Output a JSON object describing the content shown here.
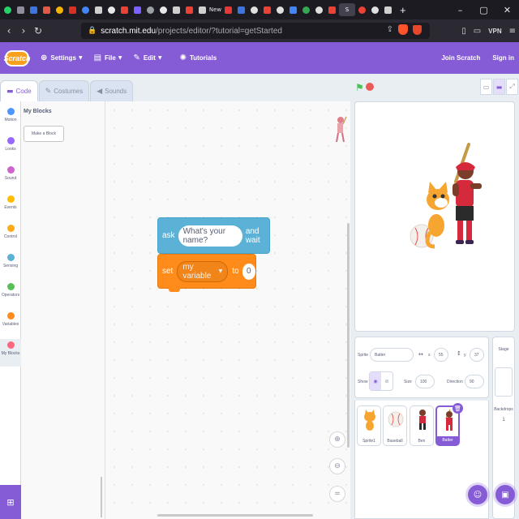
{
  "browser": {
    "tabs": [
      {
        "color": "#25d366",
        "round": true
      },
      {
        "color": "#8e8e9e",
        "round": false
      },
      {
        "color": "#3f74e0",
        "round": false
      },
      {
        "color": "#e05a47",
        "round": false
      },
      {
        "color": "#f4b400",
        "round": true
      },
      {
        "color": "#d93025",
        "round": false
      },
      {
        "color": "#4285f4",
        "round": true
      },
      {
        "color": "#d0d0d0",
        "round": false
      },
      {
        "color": "#e8e8e8",
        "round": true
      },
      {
        "color": "#ea4335",
        "round": false
      },
      {
        "color": "#7b61ff",
        "round": false
      },
      {
        "color": "#9aa0a6",
        "round": true
      },
      {
        "color": "#e8e8e8",
        "round": true
      },
      {
        "color": "#cfcfcf",
        "round": false
      },
      {
        "color": "#ea4335",
        "round": false
      },
      {
        "color": "#d0d0d0",
        "round": false
      },
      {
        "label": "New"
      },
      {
        "color": "#e53935",
        "round": false
      },
      {
        "color": "#3f74e0",
        "round": false
      },
      {
        "color": "#e0e0e0",
        "round": true
      },
      {
        "color": "#ea4335",
        "round": false
      },
      {
        "color": "#e0e0e0",
        "round": true
      },
      {
        "color": "#4285f4",
        "round": false
      },
      {
        "color": "#34a853",
        "round": true
      },
      {
        "color": "#e0e0e0",
        "round": true
      },
      {
        "color": "#ea4335",
        "round": false
      },
      {
        "label": "S",
        "active": true
      },
      {
        "color": "#ea4335",
        "round": true
      },
      {
        "color": "#e0e0e0",
        "round": true
      },
      {
        "color": "#d0d0d0",
        "round": false
      }
    ],
    "new_tab": "+",
    "url_host": "scratch.mit.edu",
    "url_path": "/projects/editor/?tutorial=getStarted",
    "vpn_label": "VPN"
  },
  "menu": {
    "logo": "Scratch",
    "settings": "Settings",
    "file": "File",
    "edit": "Edit",
    "tutorials": "Tutorials",
    "join": "Join Scratch",
    "signin": "Sign in"
  },
  "tabs": {
    "code": "Code",
    "costumes": "Costumes",
    "sounds": "Sounds"
  },
  "categories": [
    {
      "label": "Motion",
      "color": "#4c97ff"
    },
    {
      "label": "Looks",
      "color": "#9966ff"
    },
    {
      "label": "Sound",
      "color": "#cf63cf"
    },
    {
      "label": "Events",
      "color": "#ffbf00"
    },
    {
      "label": "Control",
      "color": "#ffab19"
    },
    {
      "label": "Sensing",
      "color": "#5cb1d6"
    },
    {
      "label": "Operators",
      "color": "#59c059"
    },
    {
      "label": "Variables",
      "color": "#ff8c1a"
    },
    {
      "label": "My Blocks",
      "color": "#ff6680"
    }
  ],
  "flyout": {
    "heading": "My Blocks",
    "make_block": "Make a Block"
  },
  "blocks": {
    "ask": {
      "word": "ask",
      "input": "What's your name?",
      "suffix": "and wait"
    },
    "set": {
      "word": "set",
      "variable": "my variable",
      "to": "to",
      "value": "0"
    }
  },
  "sprite_info": {
    "sprite_label": "Sprite",
    "sprite_name": "Batter",
    "x_label": "x",
    "x_value": "55",
    "y_label": "y",
    "y_value": "37",
    "show_label": "Show",
    "size_label": "Size",
    "size_value": "100",
    "direction_label": "Direction",
    "direction_value": "90"
  },
  "sprites": [
    {
      "name": "Sprite1",
      "selected": false
    },
    {
      "name": "Baseball",
      "selected": false
    },
    {
      "name": "Ben",
      "selected": false
    },
    {
      "name": "Batter",
      "selected": true
    }
  ],
  "stage_panel": {
    "title": "Stage",
    "backdrops_label": "Backdrops",
    "backdrops_count": "1"
  },
  "colors": {
    "scratch_purple": "#855cd6",
    "motion_blue": "#4c97ff",
    "sensing": "#5cb1d6",
    "variables": "#ff8c1a"
  }
}
